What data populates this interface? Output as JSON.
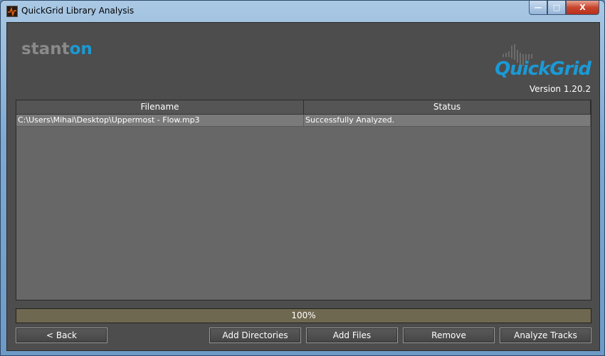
{
  "window": {
    "title": "QuickGrid Library Analysis",
    "minimize": "—",
    "maximize": "□",
    "close": "X"
  },
  "branding": {
    "stanton_prefix": "stant",
    "stanton_suffix": "on",
    "product": "QuickGrid",
    "version": "Version 1.20.2",
    "accent": "#1a9ad6"
  },
  "table": {
    "columns": [
      "Filename",
      "Status"
    ],
    "rows": [
      {
        "filename": "C:\\Users\\Mihai\\Desktop\\Uppermost - Flow.mp3",
        "status": "Successfully Analyzed."
      }
    ]
  },
  "progress": {
    "value": 100,
    "label": "100%"
  },
  "buttons": {
    "back": "< Back",
    "add_directories": "Add Directories",
    "add_files": "Add Files",
    "remove": "Remove",
    "analyze": "Analyze Tracks"
  }
}
